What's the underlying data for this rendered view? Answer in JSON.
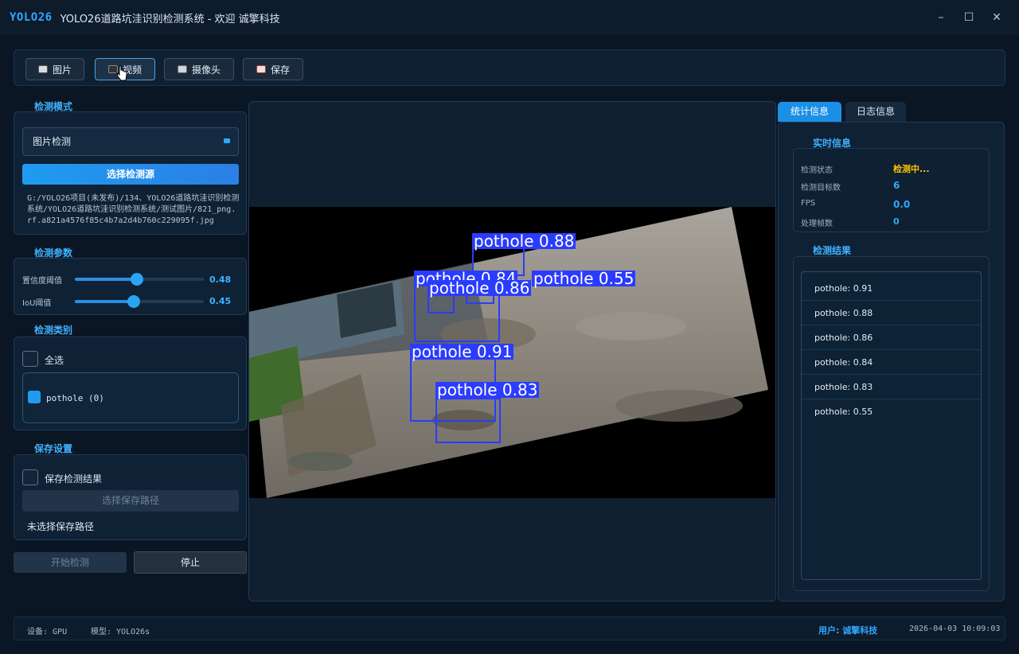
{
  "window": {
    "logo": "YOLO26",
    "title": "YOLO26道路坑洼识别检测系统 - 欢迎 诚擎科技",
    "controls": [
      "–",
      "☐",
      "✕"
    ]
  },
  "toolbar": {
    "buttons": [
      {
        "label": "图片",
        "icon": "camera-icon"
      },
      {
        "label": "视频",
        "icon": "film-icon"
      },
      {
        "label": "摄像头",
        "icon": "webcam-icon"
      },
      {
        "label": "保存",
        "icon": "save-icon"
      }
    ]
  },
  "detect_mode": {
    "title": "检测模式",
    "mode_value": "图片检测",
    "select_source_label": "选择检测源",
    "source_path": "G:/YOLO26项目(未发布)/134、YOLO26道路坑洼识别检测系统/YOLO26道路坑洼识别检测系统/测试图片/821_png.rf.a821a4576f85c4b7a2d4b760c229095f.jpg"
  },
  "params": {
    "title": "检测参数",
    "confidence_label": "置信度阈值",
    "confidence_value": "0.48",
    "confidence": 0.48,
    "iou_label": "IoU阈值",
    "iou_value": "0.45",
    "iou": 0.45
  },
  "classes": {
    "title": "检测类别",
    "select_all_label": "全选",
    "items": [
      {
        "label": "pothole (0)",
        "checked": true
      }
    ]
  },
  "save": {
    "title": "保存设置",
    "save_results_label": "保存检测结果",
    "choose_path_label": "选择保存路径",
    "path_status": "未选择保存路径"
  },
  "actions": {
    "start_label": "开始检测",
    "stop_label": "停止"
  },
  "detections": [
    {
      "label": "pothole 0.88"
    },
    {
      "label": "pothole 0.84"
    },
    {
      "label": "pothole 0.55"
    },
    {
      "label": "pothole 0.86"
    },
    {
      "label": "pothole 0.91"
    },
    {
      "label": "pothole 0.83"
    }
  ],
  "right_panel": {
    "tabs": [
      "统计信息",
      "日志信息"
    ],
    "realtime_title": "实时信息",
    "stats": [
      {
        "key": "检测状态",
        "value": "检测中..."
      },
      {
        "key": "检测目标数",
        "value": "6"
      },
      {
        "key": "FPS",
        "value": "0.0"
      },
      {
        "key": "处理帧数",
        "value": "0"
      }
    ],
    "results_title": "检测结果",
    "results": [
      "pothole: 0.91",
      "pothole: 0.88",
      "pothole: 0.86",
      "pothole: 0.84",
      "pothole: 0.83",
      "pothole: 0.55"
    ]
  },
  "statusbar": {
    "device": "设备: GPU",
    "model": "模型: YOLO26s",
    "user": "用户: 诚擎科技",
    "datetime": "2026-04-03 10:09:03"
  },
  "colors": {
    "accent": "#2fa8ff",
    "bbox": "#2a3cff",
    "status_warning": "#ffc107"
  }
}
